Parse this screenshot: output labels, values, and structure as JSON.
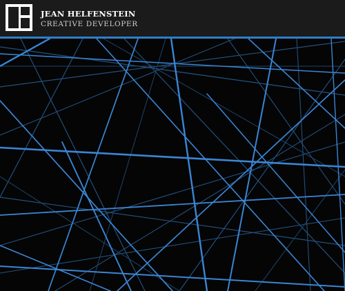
{
  "header": {
    "name": "JEAN HELFENSTEIN",
    "title": "CREATIVE DEVELOPER",
    "logo_icon": "monogram-logo-icon"
  },
  "colors": {
    "background": "#050506",
    "header_bg": "#1b1b1c",
    "accent": "#2f7fc8",
    "line_bright": "#3a86d4",
    "line_dim": "#24527f"
  }
}
